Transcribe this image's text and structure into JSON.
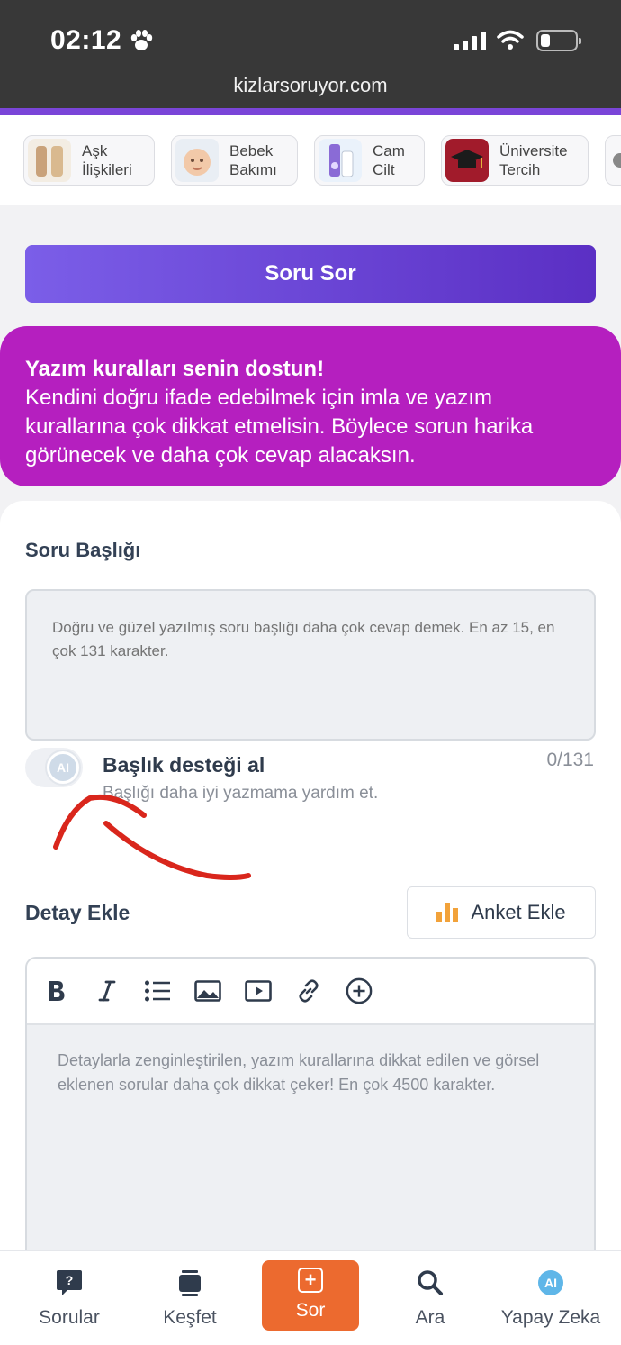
{
  "status_bar": {
    "time": "02:12",
    "url": "kizlarsoruyor.com",
    "icons": [
      "paw-icon",
      "signal-icon",
      "wifi-icon",
      "battery-icon"
    ]
  },
  "categories": [
    {
      "label": "Aşk\nİlişkileri",
      "icon": "ask-iliskileri-thumb"
    },
    {
      "label": "Bebek\nBakımı",
      "icon": "bebek-bakimi-thumb"
    },
    {
      "label": "Cam\nCilt",
      "icon": "cam-cilt-thumb"
    },
    {
      "label": "Üniversite\nTercih",
      "icon": "universite-tercih-thumb"
    }
  ],
  "ask_button": {
    "label": "Soru Sor"
  },
  "banner": {
    "title": "Yazım kuralları senin dostun!",
    "body": "Kendini doğru ifade edebilmek için imla ve yazım kurallarına çok dikkat etmelisin. Böylece sorun harika görünecek ve daha çok cevap alacaksın."
  },
  "form": {
    "title_label": "Soru Başlığı",
    "title_placeholder": "Doğru ve güzel yazılmış soru başlığı daha çok cevap demek. En az 15, en çok 131 karakter.",
    "ai_toggle_badge": "AI",
    "ai_help_title": "Başlık desteği al",
    "ai_help_subtitle": "Başlığı daha iyi yazmama yardım et.",
    "title_counter": "0/131",
    "detail_label": "Detay Ekle",
    "poll_button": "Anket Ekle",
    "editor_tools": [
      "bold-icon",
      "italic-icon",
      "list-icon",
      "image-icon",
      "video-icon",
      "link-icon",
      "plus-circle-icon"
    ],
    "detail_placeholder": "Detaylarla zenginleştirilen, yazım kurallarına dikkat edilen ve görsel eklenen sorular daha çok dikkat çeker! En çok 4500 karakter."
  },
  "bottom_nav": {
    "items": [
      {
        "label": "Sorular",
        "icon": "question-bubble-icon"
      },
      {
        "label": "Keşfet",
        "icon": "stack-icon"
      },
      {
        "label": "Sor",
        "icon": "plus-box-icon",
        "active": true
      },
      {
        "label": "Ara",
        "icon": "search-icon"
      },
      {
        "label": "Yapay Zeka",
        "icon": "ai-icon"
      }
    ],
    "ai_badge": "AI"
  },
  "colors": {
    "accent_purple": "#6a3fd6",
    "banner_magenta": "#b51fbf",
    "active_orange": "#ec6a2f",
    "annotation_red": "#d9261c"
  }
}
